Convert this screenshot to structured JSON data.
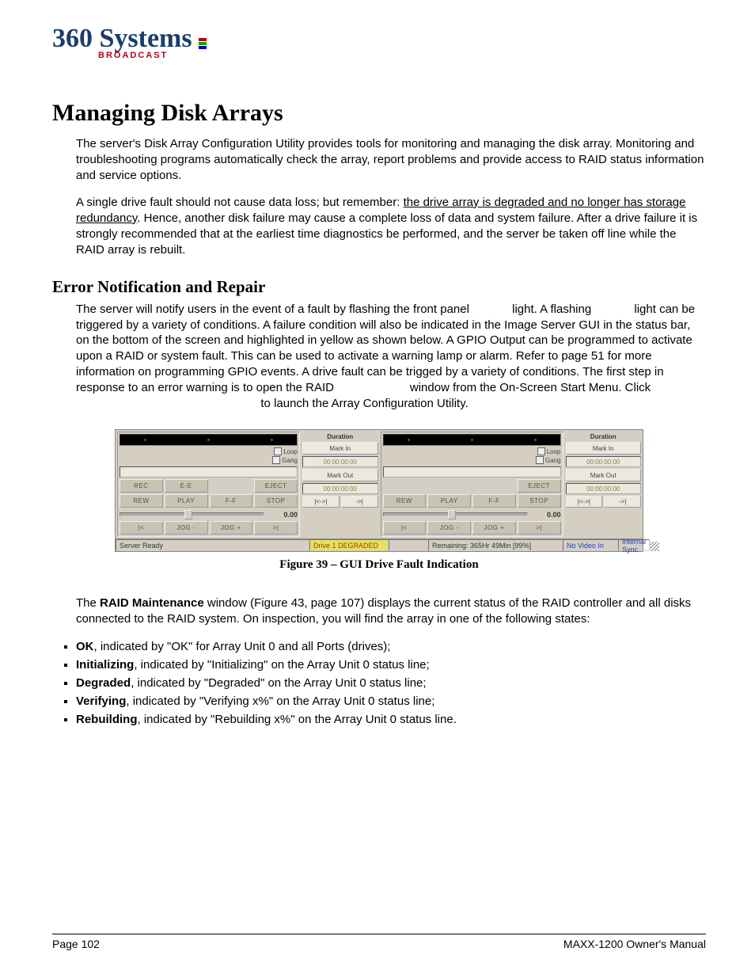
{
  "logo": {
    "script": "360 Systems",
    "sub": "BROADCAST"
  },
  "h1": "Managing Disk Arrays",
  "p1a": "The server's Disk Array Configuration Utility provides tools for monitoring and managing the disk array.  Monitoring and troubleshooting programs automatically check the array, report problems and provide access to RAID status information and service options.",
  "p2a": "A single drive fault should not cause data loss; but remember: ",
  "p2u": "the drive array is degraded and no longer has storage redundancy",
  "p2b": ".  Hence, another disk failure may cause a complete loss of data and system failure.  After a drive failure it is strongly recommended that at the earliest time diagnostics be performed, and the server be taken off line while the RAID array is rebuilt.",
  "h2": "Error Notification and Repair",
  "p3a": "The server will notify users in the event of a fault by flashing the front panel ",
  "p3b": " light.  A flashing ",
  "p3c": " light can be triggered by a variety of conditions. A failure condition will also be indicated in the Image Server GUI in the status bar, on the bottom of the screen and highlighted in yellow as shown below. A GPIO Output can be programmed to activate upon a RAID or system fault. This can be used to activate a warning lamp or alarm. Refer to page 51 for more information on programming GPIO events. A drive fault can be trigged by a variety of conditions. The first step in response to an error warning is to open the RAID ",
  "p3d": " window from the On-Screen Start Menu.  Click ",
  "p3e": " to launch the Array Configuration Utility.",
  "fig_caption": "Figure 39 – GUI Drive Fault Indication",
  "p4a": "The ",
  "p4bold": "RAID Maintenance",
  "p4b": " window (Figure 43, page 107) displays the current status of the RAID controller and all disks connected to the RAID system.  On inspection, you will find the array in one of the following states:",
  "states": [
    {
      "b": "OK",
      "t": ", indicated by \"OK\" for Array Unit 0 and all Ports (drives);"
    },
    {
      "b": "Initializing",
      "t": ", indicated by \"Initializing\" on the Array Unit 0 status line;"
    },
    {
      "b": "Degraded",
      "t": ", indicated by \"Degraded\" on the Array Unit 0 status line;"
    },
    {
      "b": "Verifying",
      "t": ", indicated by \"Verifying x%\" on the Array Unit 0 status line;"
    },
    {
      "b": "Rebuilding",
      "t": ", indicated by \"Rebuilding x%\" on the Array Unit 0 status line."
    }
  ],
  "footer": {
    "left": "Page 102",
    "right": "MAXX-1200 Owner's Manual"
  },
  "gui": {
    "loop": "Loop",
    "gang": "Gang",
    "buttons_row1": [
      "REC",
      "E-E",
      "",
      "EJECT"
    ],
    "buttons_row2": [
      "REW",
      "PLAY",
      "F-F",
      "STOP"
    ],
    "slider_val": "0.00",
    "buttons_row3": [
      "|<",
      "JOG -",
      "JOG +",
      ">|"
    ],
    "duration": "Duration",
    "mark_in": "Mark In",
    "tc": "00:00:00:00",
    "mark_out": "Mark Out",
    "mini1": "|<->|",
    "mini2": "->|",
    "status": {
      "ready": "Server Ready",
      "degraded": "Drive 1 DEGRADED",
      "remaining": "Remaining: 365Hr 49Min  [99%]",
      "novideo": "No Video In",
      "isync": "Internal Sync"
    }
  }
}
